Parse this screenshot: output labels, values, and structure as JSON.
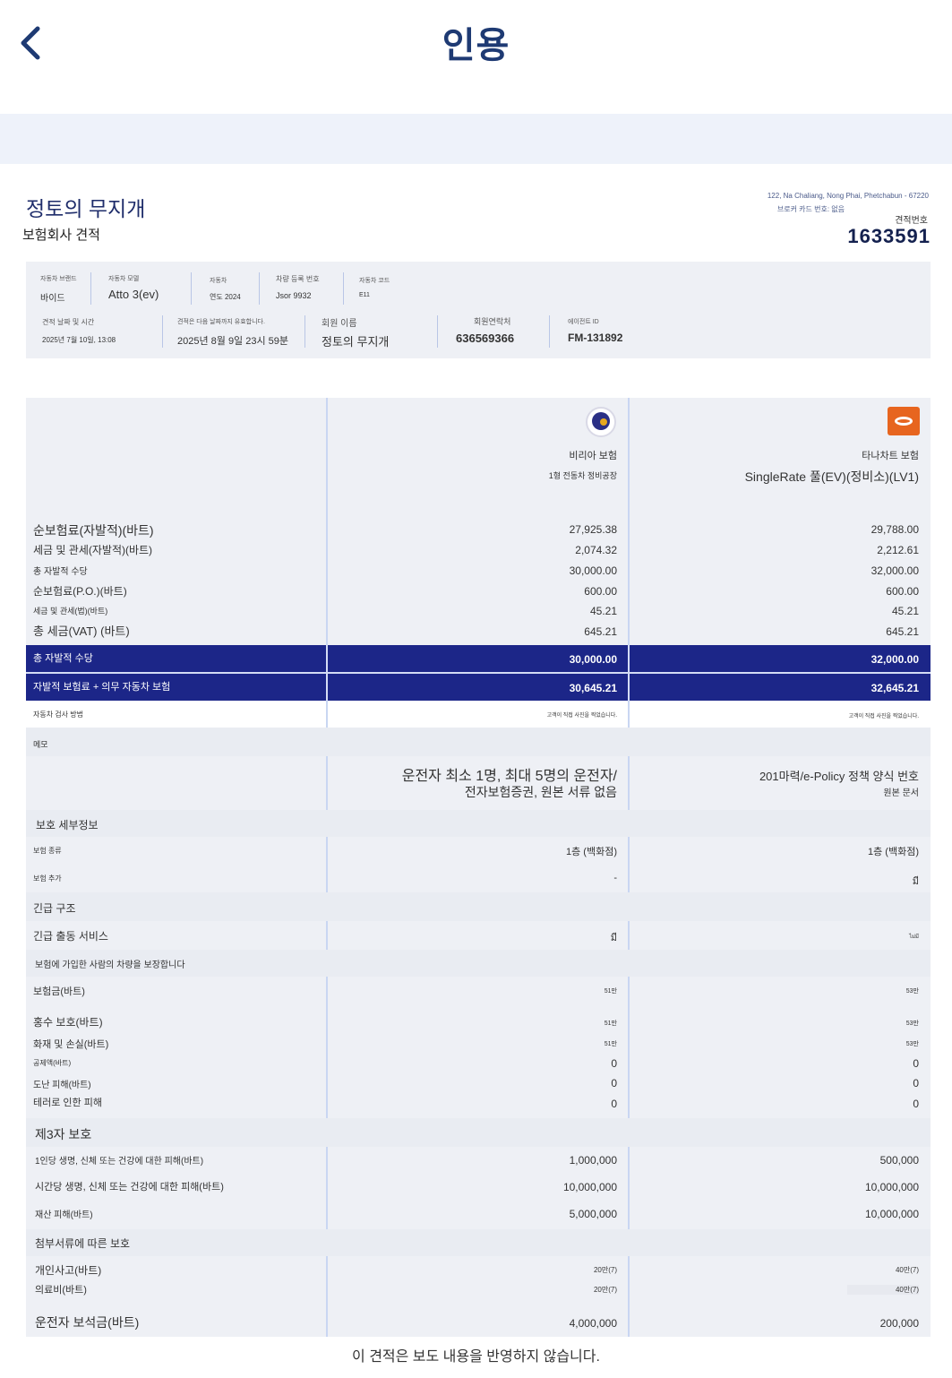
{
  "header": {
    "title": "인용",
    "back_icon": "chevron-left-icon"
  },
  "quote": {
    "member_name": "정토의 무지개",
    "company_subtitle": "보험회사 견적",
    "address": "122, Na Chaliang, Nong Phai, Phetchabun - 67220",
    "broker_code": "브로커 카드 번호: 없음",
    "quote_number_label": "견적번호",
    "quote_number": "1633591"
  },
  "info": {
    "brand_label": "자동차 브랜드",
    "brand": "바이드",
    "model_label": "자동차 모델",
    "model": "Atto 3(ev)",
    "car_label": "자동차",
    "car": "연도 2024",
    "plate_label": "차량 등록 번호",
    "plate": "Jsor 9932",
    "code_label": "자동차 코드",
    "code": "E11",
    "date_label": "견적 날짜 및 시간",
    "date": "2025년 7월 10일, 13:08",
    "valid_label": "견적은 다음 날짜까지 유효합니다.",
    "valid": "2025년 8월 9일 23시 59분",
    "member_label": "회원 이름",
    "member": "정토의 무지개",
    "phone_label": "회원연락처",
    "phone": "636569366",
    "agent_label": "에이전트 ID",
    "agent": "FM-131892"
  },
  "insurers": {
    "a": {
      "name": "비리아 보험",
      "plan": "1형 전동차 정비공장"
    },
    "b": {
      "name": "타나차트 보험",
      "plan": "SingleRate 풀(EV)(정비소)(LV1)"
    }
  },
  "premiums": [
    {
      "label": "순보험료(자발적)(바트)",
      "a": "27,925.38",
      "b": "29,788.00"
    },
    {
      "label": "세금 및 관세(자발적)(바트)",
      "a": "2,074.32",
      "b": "2,212.61"
    },
    {
      "label": "총 자발적 수당",
      "a": "30,000.00",
      "b": "32,000.00"
    },
    {
      "label": "순보험료(P.O.)(바트)",
      "a": "600.00",
      "b": "600.00"
    },
    {
      "label": "세금 및 관세(법)(바트)",
      "a": "45.21",
      "b": "45.21"
    },
    {
      "label": "총 세금(VAT) (바트)",
      "a": "645.21",
      "b": "645.21"
    }
  ],
  "totals": [
    {
      "label": "총 자발적 수당",
      "a": "30,000.00",
      "b": "32,000.00"
    },
    {
      "label": "자발적 보험료 + 의무 자동차 보험",
      "a": "30,645.21",
      "b": "32,645.21"
    }
  ],
  "inspection": {
    "label": "자동차 검사 방법",
    "a": "고객이 직접 사진을 찍었습니다.",
    "b": "고객이 직접 사진을 찍었습니다."
  },
  "memo": {
    "label": "메모",
    "a_line1": "운전자 최소 1명, 최대 5명의 운전자/",
    "a_line2": "전자보험증권, 원본 서류 없음",
    "b_line1": "201마력/e-Policy 정책 양식 번호",
    "b_line2": "원본 문서"
  },
  "protection": {
    "title": "보호 세부정보",
    "type_label": "보험 종류",
    "type_a": "1층 (백화점)",
    "type_b": "1층 (백화점)",
    "extra_label": "보험 추가",
    "extra_a": "-",
    "extra_b": "มี"
  },
  "emergency": {
    "title": "긴급 구조",
    "service_label": "긴급 출동 서비스",
    "service_a": "มี",
    "service_b": "ไม่มี"
  },
  "vehicle": {
    "title": "보험에 가입한 사람의 차량을 보장합니다",
    "rows": [
      {
        "label": "보험금(바트)",
        "a": "51만",
        "b": "53만"
      },
      {
        "label": "홍수 보호(바트)",
        "a": "51만",
        "b": "53만"
      },
      {
        "label": "화재 및 손실(바트)",
        "a": "51만",
        "b": "53만"
      },
      {
        "label": "공제액(바트)",
        "a": "0",
        "b": "0"
      },
      {
        "label": "도난 피해(바트)",
        "a": "0",
        "b": "0"
      },
      {
        "label": "테러로 인한 피해",
        "a": "0",
        "b": "0"
      }
    ]
  },
  "third_party": {
    "title": "제3자 보호",
    "rows": [
      {
        "label": "1인당 생명, 신체 또는 건강에 대한 피해(바트)",
        "a": "1,000,000",
        "b": "500,000"
      },
      {
        "label": "시간당 생명, 신체 또는 건강에 대한 피해(바트)",
        "a": "10,000,000",
        "b": "10,000,000"
      },
      {
        "label": "재산 피해(바트)",
        "a": "5,000,000",
        "b": "10,000,000"
      }
    ]
  },
  "attachments": {
    "title": "첨부서류에 따른 보호",
    "rows": [
      {
        "label": "개인사고(바트)",
        "a": "20만(7)",
        "b": "40만(7)"
      },
      {
        "label": "의료비(바트)",
        "a": "20만(7)",
        "b": "40만(7)"
      },
      {
        "label": "운전자 보석금(바트)",
        "a": "4,000,000",
        "b": "200,000"
      }
    ]
  },
  "footer": {
    "note": "이 견적은 보도 내용을 반영하지 않습니다."
  },
  "colors": {
    "primary": "#1c2688",
    "title": "#1e3a73",
    "band": "#eef2fa",
    "insurer_b_brand": "#e7651f"
  }
}
